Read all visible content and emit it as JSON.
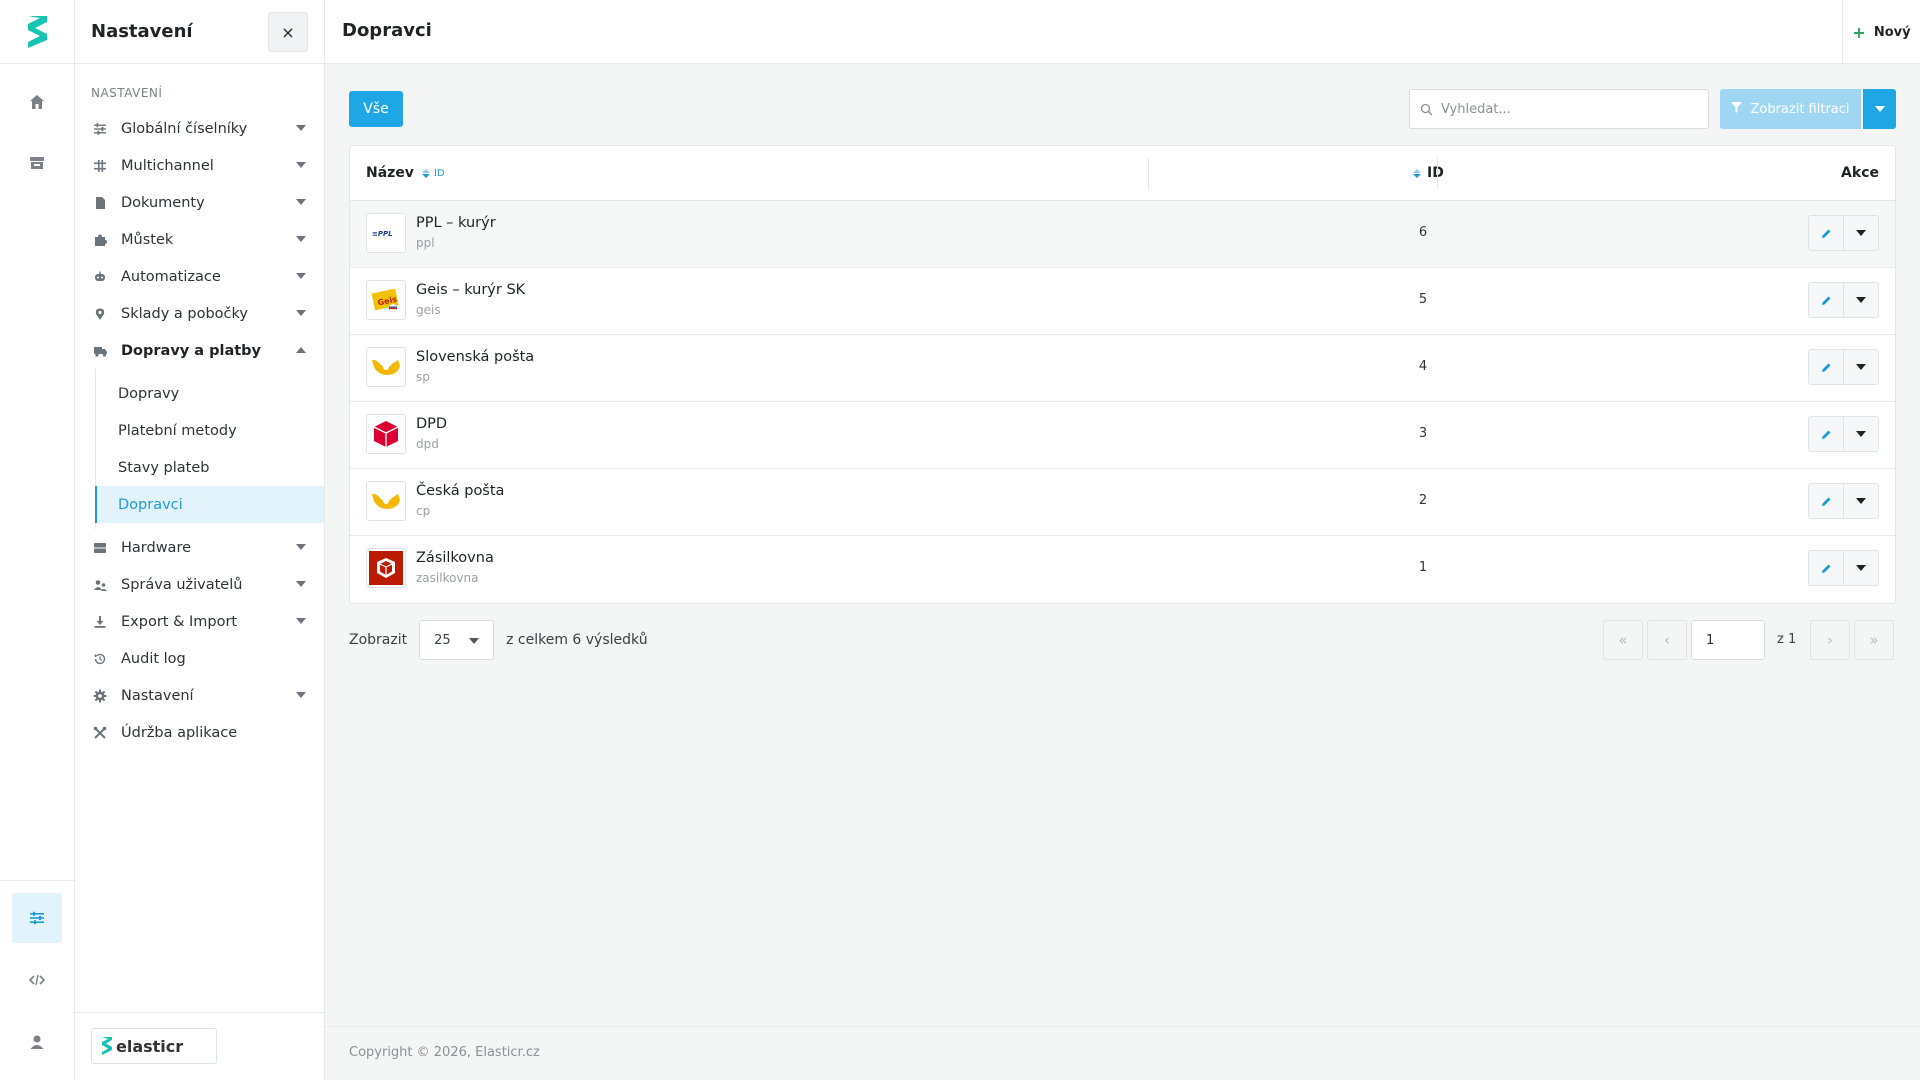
{
  "sidebar": {
    "title": "Nastavení",
    "close_glyph": "×",
    "section": "NASTAVENÍ",
    "items": [
      {
        "label": "Globální číselníky",
        "icon": "sliders-icon"
      },
      {
        "label": "Multichannel",
        "icon": "channels-icon"
      },
      {
        "label": "Dokumenty",
        "icon": "document-icon"
      },
      {
        "label": "Můstek",
        "icon": "puzzle-icon"
      },
      {
        "label": "Automatizace",
        "icon": "robot-icon"
      },
      {
        "label": "Sklady a pobočky",
        "icon": "map-pin-icon"
      },
      {
        "label": "Dopravy a platby",
        "icon": "truck-icon"
      }
    ],
    "subitems": [
      {
        "label": "Dopravy"
      },
      {
        "label": "Platební metody"
      },
      {
        "label": "Stavy plateb"
      },
      {
        "label": "Dopravci"
      }
    ],
    "items_after": [
      {
        "label": "Hardware",
        "icon": "server-icon"
      },
      {
        "label": "Správa uživatelů",
        "icon": "users-icon"
      },
      {
        "label": "Export & Import",
        "icon": "download-icon"
      },
      {
        "label": "Audit log",
        "icon": "history-icon"
      },
      {
        "label": "Nastavení",
        "icon": "gear-icon"
      },
      {
        "label": "Údržba aplikace",
        "icon": "tools-icon"
      }
    ],
    "brand": "elasticr"
  },
  "header": {
    "title": "Dopravci",
    "new_label": "Nový"
  },
  "toolbar": {
    "all_label": "Vše",
    "search_placeholder": "Vyhledat...",
    "filter_label": "Zobrazit filtraci"
  },
  "table": {
    "col_name": "Název",
    "col_name_sub": "ID",
    "col_id": "ID",
    "col_actions": "Akce",
    "rows": [
      {
        "name": "PPL – kurýr",
        "code": "ppl",
        "id": "6",
        "logo": "ppl-logo"
      },
      {
        "name": "Geis – kurýr SK",
        "code": "geis",
        "id": "5",
        "logo": "geis-logo"
      },
      {
        "name": "Slovenská pošta",
        "code": "sp",
        "id": "4",
        "logo": "horn-logo"
      },
      {
        "name": "DPD",
        "code": "dpd",
        "id": "3",
        "logo": "dpd-logo"
      },
      {
        "name": "Česká pošta",
        "code": "cp",
        "id": "2",
        "logo": "horn-logo"
      },
      {
        "name": "Zásilkovna",
        "code": "zasilkovna",
        "id": "1",
        "logo": "zasilkovna-logo"
      }
    ]
  },
  "pagination": {
    "show_label": "Zobrazit",
    "page_size": "25",
    "total_label": "z celkem 6 výsledků",
    "page": "1",
    "of_label": "z 1"
  },
  "footer": {
    "copyright": "Copyright © 2026, Elasticr.cz"
  },
  "colors": {
    "accent": "#1ea7e4",
    "accent_light": "#9fd6f1",
    "active_bg": "#e3f3fb"
  }
}
